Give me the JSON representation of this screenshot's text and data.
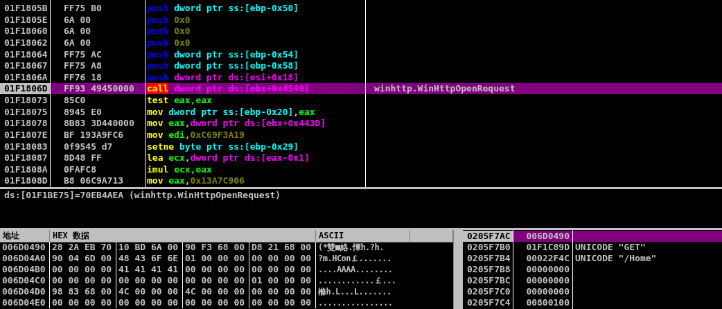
{
  "disassembly": {
    "rows": [
      {
        "address": "01F1805B",
        "bytes": "FF75 B0",
        "selected": false,
        "mnemonic": {
          "text": "push",
          "kind": "push"
        },
        "operands": [
          {
            "text": "dword ptr ss:[ebp-0x50]",
            "kind": "stack"
          }
        ]
      },
      {
        "address": "01F1805E",
        "bytes": "6A 00",
        "selected": false,
        "mnemonic": {
          "text": "push",
          "kind": "push"
        },
        "operands": [
          {
            "text": "0x0",
            "kind": "imm"
          }
        ]
      },
      {
        "address": "01F18060",
        "bytes": "6A 00",
        "selected": false,
        "mnemonic": {
          "text": "push",
          "kind": "push"
        },
        "operands": [
          {
            "text": "0x0",
            "kind": "imm"
          }
        ]
      },
      {
        "address": "01F18062",
        "bytes": "6A 00",
        "selected": false,
        "mnemonic": {
          "text": "push",
          "kind": "push"
        },
        "operands": [
          {
            "text": "0x0",
            "kind": "imm"
          }
        ]
      },
      {
        "address": "01F18064",
        "bytes": "FF75 AC",
        "selected": false,
        "mnemonic": {
          "text": "push",
          "kind": "push"
        },
        "operands": [
          {
            "text": "dword ptr ss:[ebp-0x54]",
            "kind": "stack"
          }
        ]
      },
      {
        "address": "01F18067",
        "bytes": "FF75 A8",
        "selected": false,
        "mnemonic": {
          "text": "push",
          "kind": "push"
        },
        "operands": [
          {
            "text": "dword ptr ss:[ebp-0x58]",
            "kind": "stack"
          }
        ]
      },
      {
        "address": "01F1806A",
        "bytes": "FF76 18",
        "selected": false,
        "mnemonic": {
          "text": "push",
          "kind": "push"
        },
        "operands": [
          {
            "text": "dword ptr ds:[esi+0x18]",
            "kind": "mem"
          }
        ]
      },
      {
        "address": "01F1806D",
        "bytes": "FF93 49450000",
        "selected": true,
        "mnemonic": {
          "text": "call",
          "kind": "call"
        },
        "operands": [
          {
            "text": "dword ptr ds:[ebx+0x4549]",
            "kind": "mem"
          }
        ],
        "comment": "winhttp.WinHttpOpenRequest"
      },
      {
        "address": "01F18073",
        "bytes": "85C0",
        "selected": false,
        "mnemonic": {
          "text": "test",
          "kind": "op"
        },
        "operands": [
          {
            "text": "eax,eax",
            "kind": "reg"
          }
        ]
      },
      {
        "address": "01F18075",
        "bytes": "8945 E0",
        "selected": false,
        "mnemonic": {
          "text": "mov",
          "kind": "op"
        },
        "operands": [
          {
            "text": "dword ptr ss:[ebp-0x20]",
            "kind": "stack"
          },
          {
            "text": ",",
            "kind": "punct"
          },
          {
            "text": "eax",
            "kind": "reg"
          }
        ]
      },
      {
        "address": "01F18078",
        "bytes": "8B83 3D440000",
        "selected": false,
        "mnemonic": {
          "text": "mov",
          "kind": "op"
        },
        "operands": [
          {
            "text": "eax",
            "kind": "reg"
          },
          {
            "text": ",",
            "kind": "punct"
          },
          {
            "text": "dword ptr ds:[ebx+0x443D]",
            "kind": "mem"
          }
        ]
      },
      {
        "address": "01F1807E",
        "bytes": "BF 193A9FC6",
        "selected": false,
        "mnemonic": {
          "text": "mov",
          "kind": "op"
        },
        "operands": [
          {
            "text": "edi",
            "kind": "reg"
          },
          {
            "text": ",",
            "kind": "punct"
          },
          {
            "text": "0xC69F3A19",
            "kind": "imm"
          }
        ]
      },
      {
        "address": "01F18083",
        "bytes": "0f9545 d7",
        "selected": false,
        "mnemonic": {
          "text": "setne",
          "kind": "op"
        },
        "operands": [
          {
            "text": "byte ptr ss:[ebp-0x29]",
            "kind": "stack"
          }
        ]
      },
      {
        "address": "01F18087",
        "bytes": "8D48 FF",
        "selected": false,
        "mnemonic": {
          "text": "lea",
          "kind": "op"
        },
        "operands": [
          {
            "text": "ecx",
            "kind": "reg"
          },
          {
            "text": ",",
            "kind": "punct"
          },
          {
            "text": "dword ptr ds:[eax-0x1]",
            "kind": "mem"
          }
        ]
      },
      {
        "address": "01F1808A",
        "bytes": "0FAFC8",
        "selected": false,
        "mnemonic": {
          "text": "imul",
          "kind": "op"
        },
        "operands": [
          {
            "text": "ecx,eax",
            "kind": "reg"
          }
        ]
      },
      {
        "address": "01F1808D",
        "bytes": "B8 06C9A713",
        "selected": false,
        "mnemonic": {
          "text": "mov",
          "kind": "op"
        },
        "operands": [
          {
            "text": "eax",
            "kind": "reg"
          },
          {
            "text": ",",
            "kind": "punct"
          },
          {
            "text": "0x13A7C906",
            "kind": "imm"
          }
        ]
      }
    ]
  },
  "info": "ds:[01F1BE75]=70EB4AEA (winhttp.WinHttpOpenRequest)",
  "dump": {
    "columns": [
      "地址",
      "HEX 数据",
      "ASCII"
    ],
    "rows": [
      {
        "address": "006D0490",
        "hex": [
          "28 2A EB 70",
          "10 BD 6A 00",
          "90 F3 68 00",
          "D8 21 68 00"
        ],
        "ascii": "(*雙■絡.憛h.?h."
      },
      {
        "address": "006D04A0",
        "hex": [
          "90 04 6D 00",
          "48 43 6F 6E",
          "01 00 00 00",
          "00 00 00 00"
        ],
        "ascii": "?m.HCon￡......."
      },
      {
        "address": "006D04B0",
        "hex": [
          "00 00 00 00",
          "41 41 41 41",
          "00 00 00 00",
          "00 00 00 00"
        ],
        "ascii": "....AAAA........"
      },
      {
        "address": "006D04C0",
        "hex": [
          "00 00 00 00",
          "00 00 00 00",
          "00 00 00 00",
          "01 00 00 00"
        ],
        "ascii": "............￡..."
      },
      {
        "address": "006D04D0",
        "hex": [
          "98 83 68 00",
          "4C 00 00 00",
          "4C 00 00 00",
          "00 00 00 00"
        ],
        "ascii": "樤h.L...L......."
      },
      {
        "address": "006D04E0",
        "hex": [
          "00 00 00 00",
          "00 00 00 00",
          "00 00 00 00",
          "00 00 00 00"
        ],
        "ascii": "................"
      }
    ]
  },
  "stack": {
    "rows": [
      {
        "address": "0205F7AC",
        "value": "006D0490",
        "selected": true
      },
      {
        "address": "0205F7B0",
        "value": "01F1C89D",
        "selected": false,
        "comment": "UNICODE \"GET\""
      },
      {
        "address": "0205F7B4",
        "value": "00022F4C",
        "selected": false,
        "comment": "UNICODE \"/Home\""
      },
      {
        "address": "0205F7B8",
        "value": "00000000",
        "selected": false
      },
      {
        "address": "0205F7BC",
        "value": "00000000",
        "selected": false
      },
      {
        "address": "0205F7C0",
        "value": "00000000",
        "selected": false
      },
      {
        "address": "0205F7C4",
        "value": "00800100",
        "selected": false
      }
    ]
  }
}
